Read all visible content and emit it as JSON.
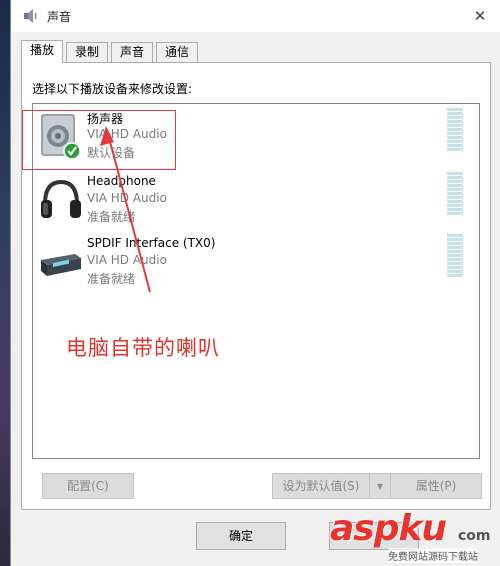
{
  "window": {
    "title": "声音",
    "close_symbol": "✕"
  },
  "tabs": [
    {
      "label": "播放",
      "active": true
    },
    {
      "label": "录制",
      "active": false
    },
    {
      "label": "声音",
      "active": false
    },
    {
      "label": "通信",
      "active": false
    }
  ],
  "panel": {
    "instruction": "选择以下播放设备来修改设置:"
  },
  "devices": [
    {
      "name": "扬声器",
      "driver": "VIA HD Audio",
      "status": "默认设备",
      "icon": "speaker-icon",
      "default": true
    },
    {
      "name": "Headphone",
      "driver": "VIA HD Audio",
      "status": "准备就绪",
      "icon": "headphone-icon",
      "default": false
    },
    {
      "name": "SPDIF Interface (TX0)",
      "driver": "VIA HD Audio",
      "status": "准备就绪",
      "icon": "spdif-icon",
      "default": false
    }
  ],
  "annotation": {
    "text": "电脑自带的喇叭",
    "color": "#e0332d"
  },
  "buttons": {
    "configure": "配置(C)",
    "set_default": "设为默认值(S)",
    "set_default_arrow": "▾",
    "properties": "属性(P)",
    "ok": "确定"
  },
  "watermark": {
    "logo_main": "aspku",
    "logo_suffix": "com",
    "subtitle": "免费网站源码下载站"
  },
  "colors": {
    "accent_red": "#e03c3c",
    "meter": "#c6e3ec",
    "check_green": "#2e9e3a"
  }
}
